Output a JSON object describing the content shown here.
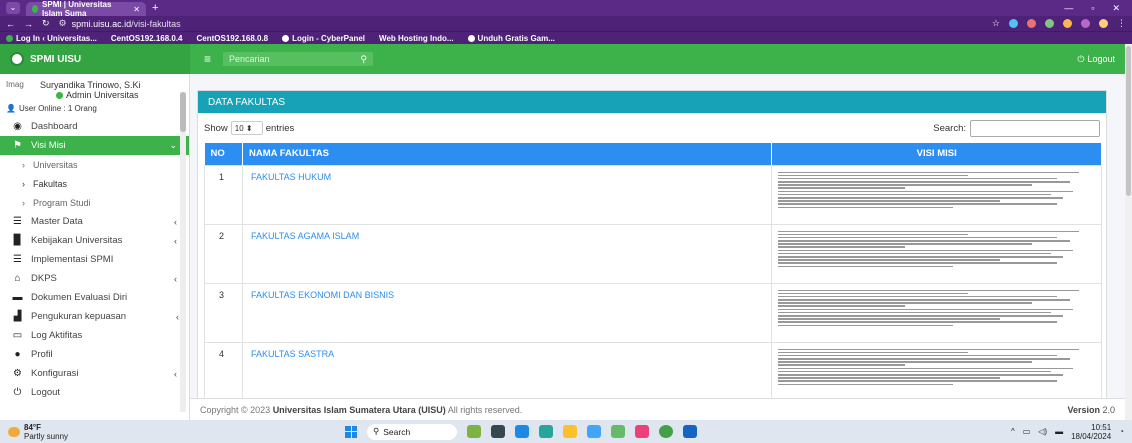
{
  "browser": {
    "tab_title": "SPMI | Universitas Islam Suma",
    "url_host": "spmi.uisu.ac.id",
    "url_path": "/visi-fakultas",
    "bookmarks": [
      "Log In ‹ Universitas...",
      "CentOS192.168.0.4",
      "CentOS192.168.0.8",
      "Login - CyberPanel",
      "Web Hosting Indo...",
      "Unduh Gratis Gam..."
    ]
  },
  "header": {
    "brand": "SPMI UISU",
    "search_placeholder": "Pencarian",
    "logout": "Logout"
  },
  "sidebar": {
    "img_alt": "Imag",
    "user_name": "Suryandika Trinowo, S.Ki",
    "user_role": "Admin Universitas",
    "online": "User Online : 1 Orang",
    "items": [
      {
        "label": "Dashboard"
      },
      {
        "label": "Visi Misi"
      },
      {
        "label": "Universitas"
      },
      {
        "label": "Fakultas"
      },
      {
        "label": "Program Studi"
      },
      {
        "label": "Master Data"
      },
      {
        "label": "Kebijakan Universitas"
      },
      {
        "label": "Implementasi SPMI"
      },
      {
        "label": "DKPS"
      },
      {
        "label": "Dokumen Evaluasi Diri"
      },
      {
        "label": "Pengukuran kepuasan"
      },
      {
        "label": "Log Aktifitas"
      },
      {
        "label": "Profil"
      },
      {
        "label": "Konfigurasi"
      },
      {
        "label": "Logout"
      }
    ]
  },
  "card": {
    "title": "DATA FAKULTAS",
    "show_label": "Show",
    "show_value": "10",
    "entries_label": "entries",
    "search_label": "Search:",
    "columns": [
      "NO",
      "NAMA FAKULTAS",
      "VISI MISI"
    ],
    "rows": [
      {
        "no": "1",
        "nama": "FAKULTAS HUKUM"
      },
      {
        "no": "2",
        "nama": "FAKULTAS AGAMA ISLAM"
      },
      {
        "no": "3",
        "nama": "FAKULTAS EKONOMI DAN BISNIS"
      },
      {
        "no": "4",
        "nama": "FAKULTAS SASTRA"
      }
    ]
  },
  "footer": {
    "copyright_prefix": "Copyright © 2023",
    "copyright_org": "Universitas Islam Sumatera Utara (UISU)",
    "copyright_suffix": "All rights reserved.",
    "version_label": "Version",
    "version": "2.0"
  },
  "taskbar": {
    "temp": "84°F",
    "weather": "Partly sunny",
    "search": "Search",
    "time": "10:51",
    "date": "18/04/2024"
  }
}
